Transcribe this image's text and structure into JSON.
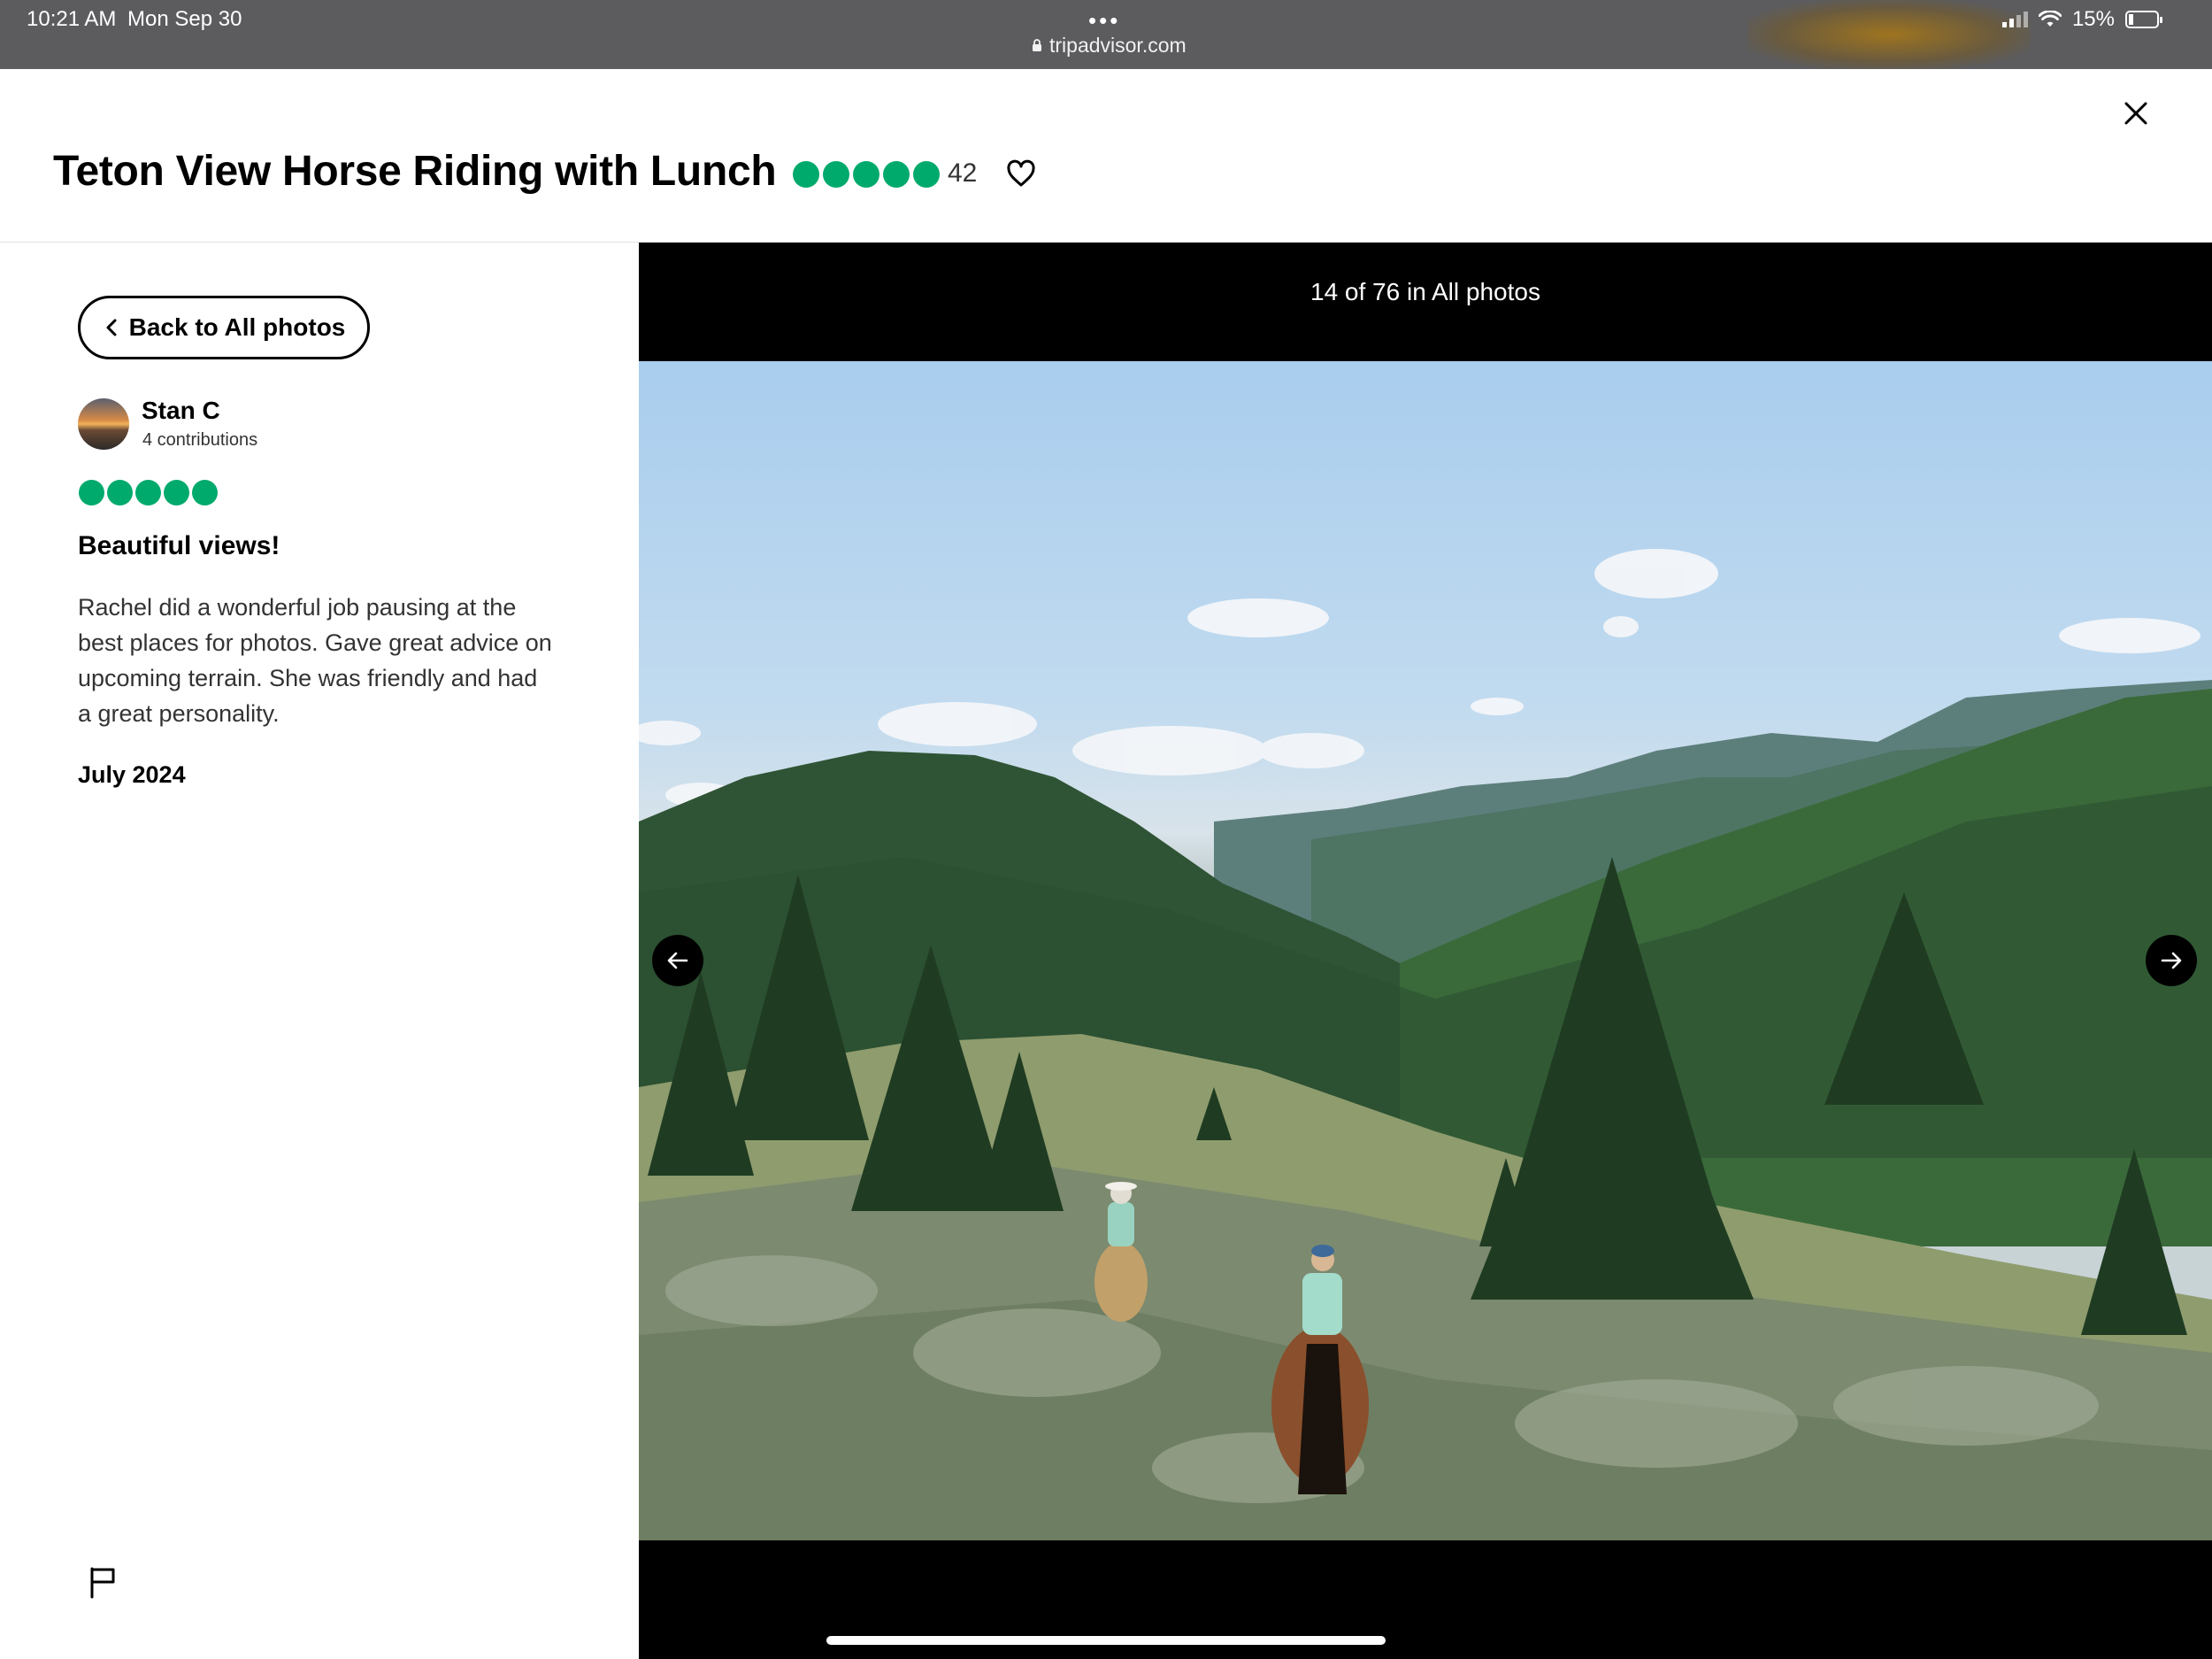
{
  "status_bar": {
    "time": "10:21 AM",
    "date": "Mon Sep 30",
    "url": "tripadvisor.com",
    "battery": "15%"
  },
  "header": {
    "title": "Teton View Horse Riding with Lunch",
    "rating_bubbles": 5,
    "review_count": "42",
    "brand_color": "#00aa6c"
  },
  "sidebar": {
    "back_label": "Back to All photos",
    "author": {
      "name": "Stan C",
      "contributions": "4 contributions"
    },
    "review": {
      "rating_bubbles": 5,
      "title": "Beautiful views!",
      "body": "Rachel did a wonderful job pausing at the best places for photos. Gave great advice on upcoming terrain. She was friendly and had a great personality.",
      "date": "July 2024"
    },
    "icons": [
      "chevron-left-icon",
      "flag-icon"
    ]
  },
  "viewer": {
    "counter": "14 of 76 in All photos",
    "icons": [
      "arrow-left-icon",
      "arrow-right-icon",
      "close-icon",
      "heart-icon"
    ]
  }
}
